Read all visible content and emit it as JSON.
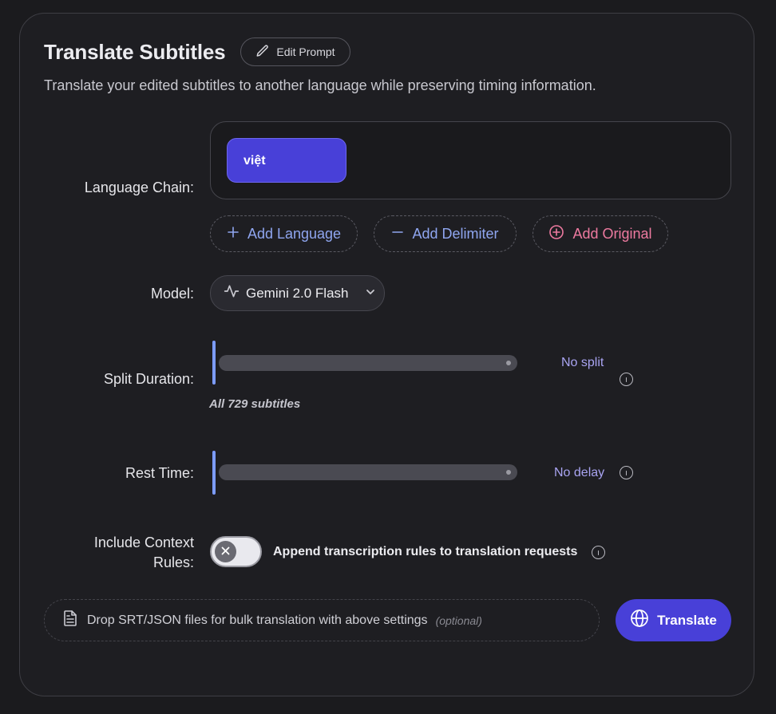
{
  "header": {
    "title": "Translate Subtitles",
    "edit_prompt_label": "Edit Prompt",
    "description": "Translate your edited subtitles to another language while preserving timing information."
  },
  "language_chain": {
    "label": "Language Chain:",
    "chips": [
      "việt"
    ],
    "add_language_label": "Add Language",
    "add_delimiter_label": "Add Delimiter",
    "add_original_label": "Add Original"
  },
  "model": {
    "label": "Model:",
    "selected": "Gemini 2.0 Flash"
  },
  "split_duration": {
    "label": "Split Duration:",
    "value_text": "No split",
    "note": "All 729 subtitles",
    "level": 0
  },
  "rest_time": {
    "label": "Rest Time:",
    "value_text": "No delay",
    "level": 0
  },
  "context_rules": {
    "label_line1": "Include Context",
    "label_line2": "Rules:",
    "toggle_text": "Append transcription rules to translation requests",
    "enabled": false
  },
  "bulk": {
    "drop_text": "Drop SRT/JSON files for bulk translation with above settings",
    "optional_text": "(optional)"
  },
  "actions": {
    "translate_label": "Translate"
  },
  "colors": {
    "accent": "#4840d8",
    "link_blue": "#8fa6f0",
    "link_pink": "#ee7aa0",
    "value_purple": "#a9a4f2",
    "slider_handle": "#7d9cff"
  }
}
